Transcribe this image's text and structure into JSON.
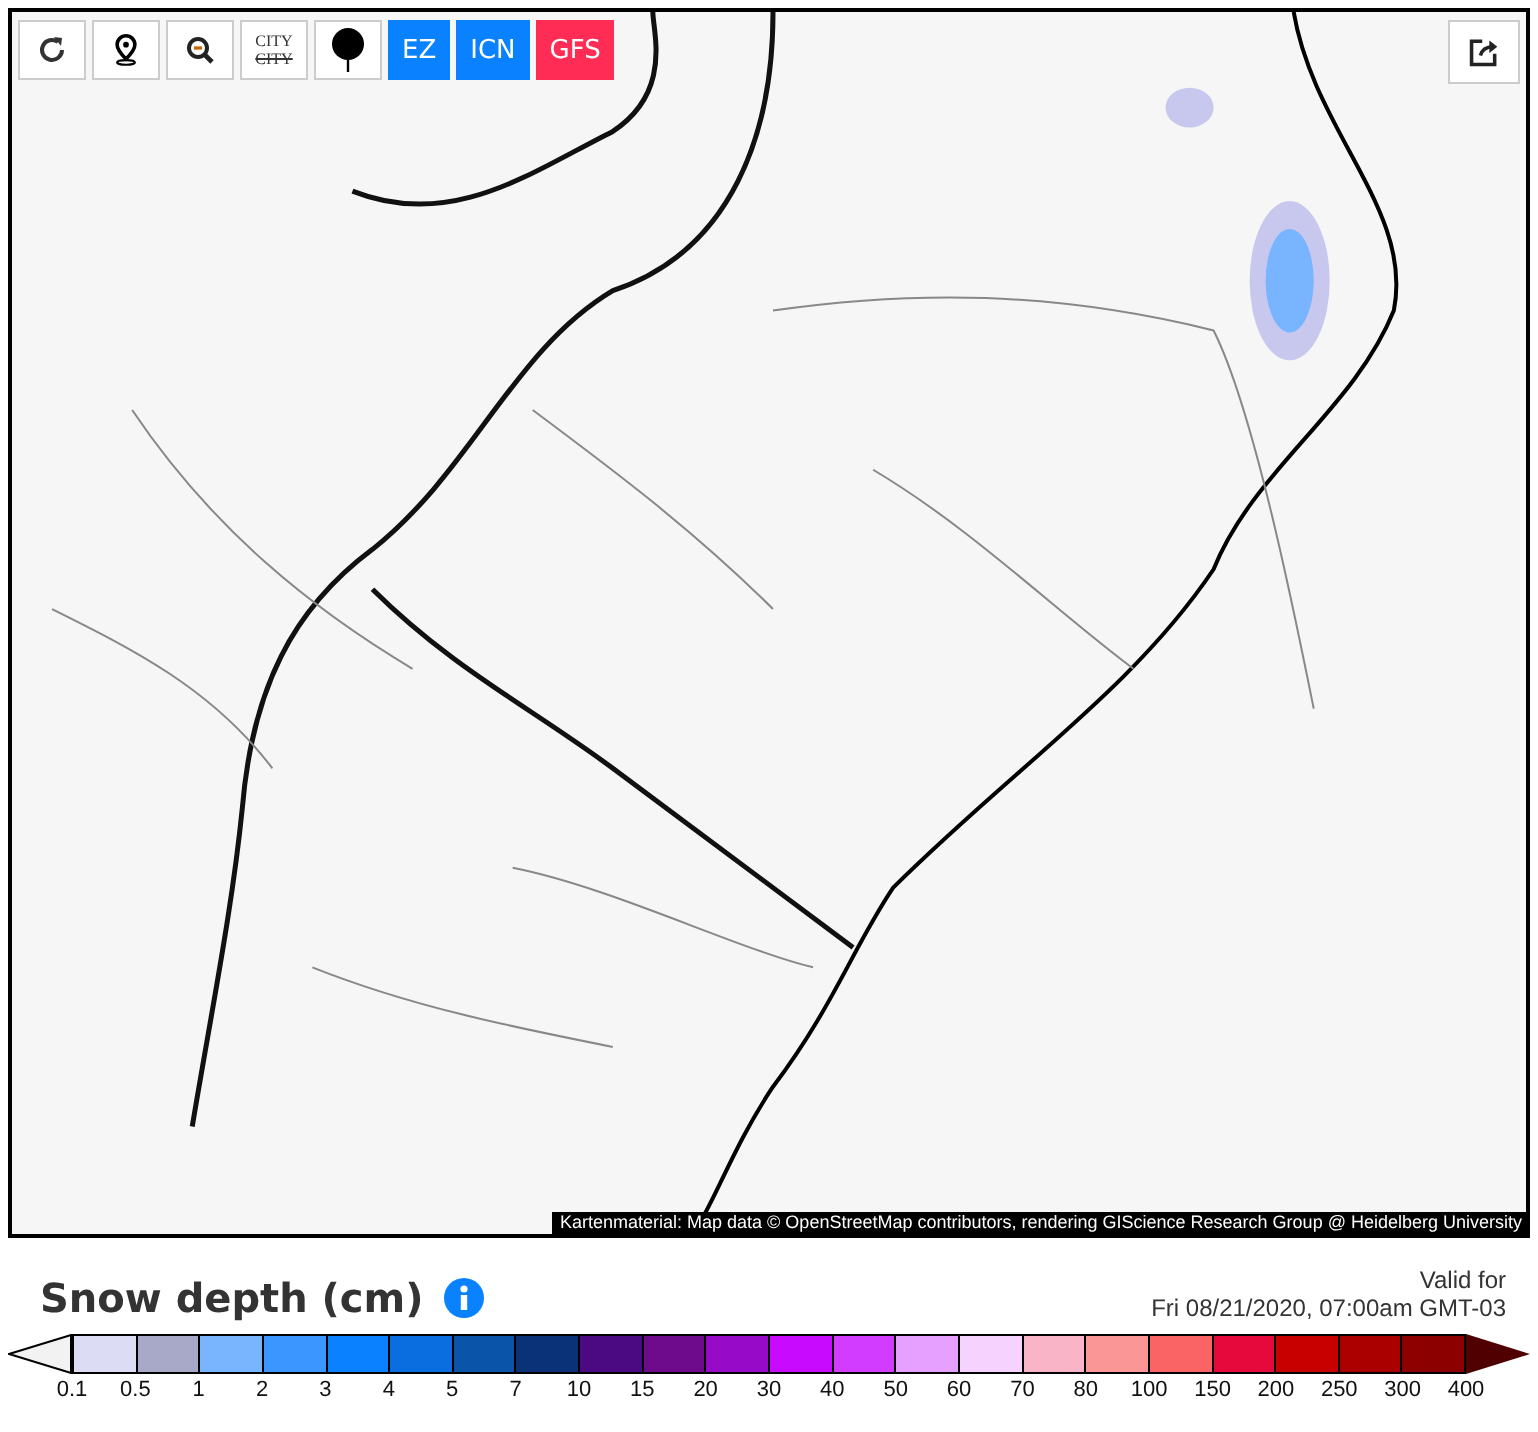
{
  "toolbar": {
    "tools": [
      {
        "kind": "reload"
      },
      {
        "kind": "locate"
      },
      {
        "kind": "zoom_out"
      },
      {
        "kind": "city",
        "lines": [
          "CITY",
          "CITY"
        ]
      },
      {
        "kind": "marker"
      }
    ],
    "models": [
      {
        "label": "EZ",
        "selected": false
      },
      {
        "label": "ICN",
        "selected": false
      },
      {
        "label": "GFS",
        "selected": true
      }
    ]
  },
  "map": {
    "attribution": "Kartenmaterial: Map data © OpenStreetMap contributors, rendering GIScience Research Group @ Heidelberg University"
  },
  "legend": {
    "title": "Snow depth (cm)",
    "valid_label": "Valid for",
    "valid_time": "Fri 08/21/2020, 07:00am GMT-03",
    "arrows": [
      {
        "kind": "below",
        "color": "#f2f2f2"
      },
      {
        "kind": "above",
        "color": "#500000"
      }
    ],
    "bins": [
      {
        "color": "#dcdcf5"
      },
      {
        "color": "#a8a8c8"
      },
      {
        "color": "#78b4ff"
      },
      {
        "color": "#3c96ff"
      },
      {
        "color": "#0a82ff"
      },
      {
        "color": "#0a6ee0"
      },
      {
        "color": "#0a55aa"
      },
      {
        "color": "#0a3278"
      },
      {
        "color": "#4b0a82"
      },
      {
        "color": "#6e0a8c"
      },
      {
        "color": "#960ac8"
      },
      {
        "color": "#c80aff"
      },
      {
        "color": "#d23cff"
      },
      {
        "color": "#e6a0ff"
      },
      {
        "color": "#f5d2ff"
      },
      {
        "color": "#fab4c8"
      },
      {
        "color": "#fa9696"
      },
      {
        "color": "#fa6464"
      },
      {
        "color": "#e60a3c"
      },
      {
        "color": "#c80000"
      },
      {
        "color": "#aa0000"
      },
      {
        "color": "#8c0000"
      }
    ],
    "ticks": [
      "0.1",
      "0.5",
      "1",
      "2",
      "3",
      "4",
      "5",
      "7",
      "10",
      "15",
      "20",
      "30",
      "40",
      "50",
      "60",
      "70",
      "80",
      "100",
      "150",
      "200",
      "250",
      "300",
      "400"
    ]
  }
}
